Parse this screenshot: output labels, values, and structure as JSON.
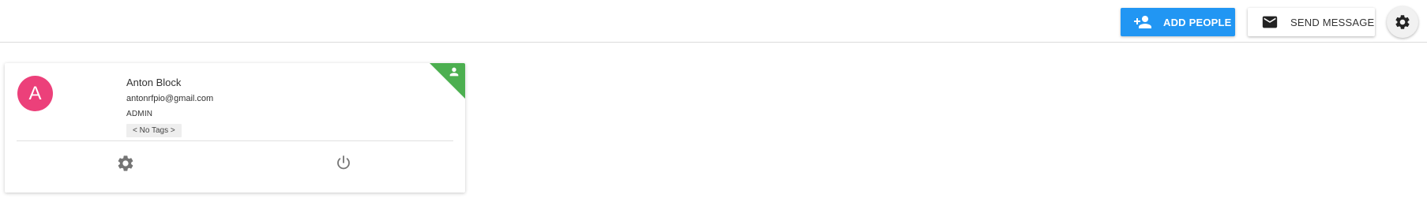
{
  "toolbar": {
    "add_people_label": "ADD PEOPLE",
    "send_message_label": "SEND MESSAGE",
    "add_people_icon": "person-add-icon",
    "send_message_icon": "mail-icon",
    "settings_icon": "gear-icon"
  },
  "card": {
    "avatar_letter": "A",
    "name": "Anton Block",
    "email": "antonrfpio@gmail.com",
    "role": "ADMIN",
    "tags": "< No Tags >",
    "corner_icon": "person-icon",
    "actions": [
      "gear-icon",
      "power-icon"
    ]
  },
  "colors": {
    "primary": "#2196f3",
    "avatar": "#ec407a",
    "corner_badge": "#4caf50"
  }
}
